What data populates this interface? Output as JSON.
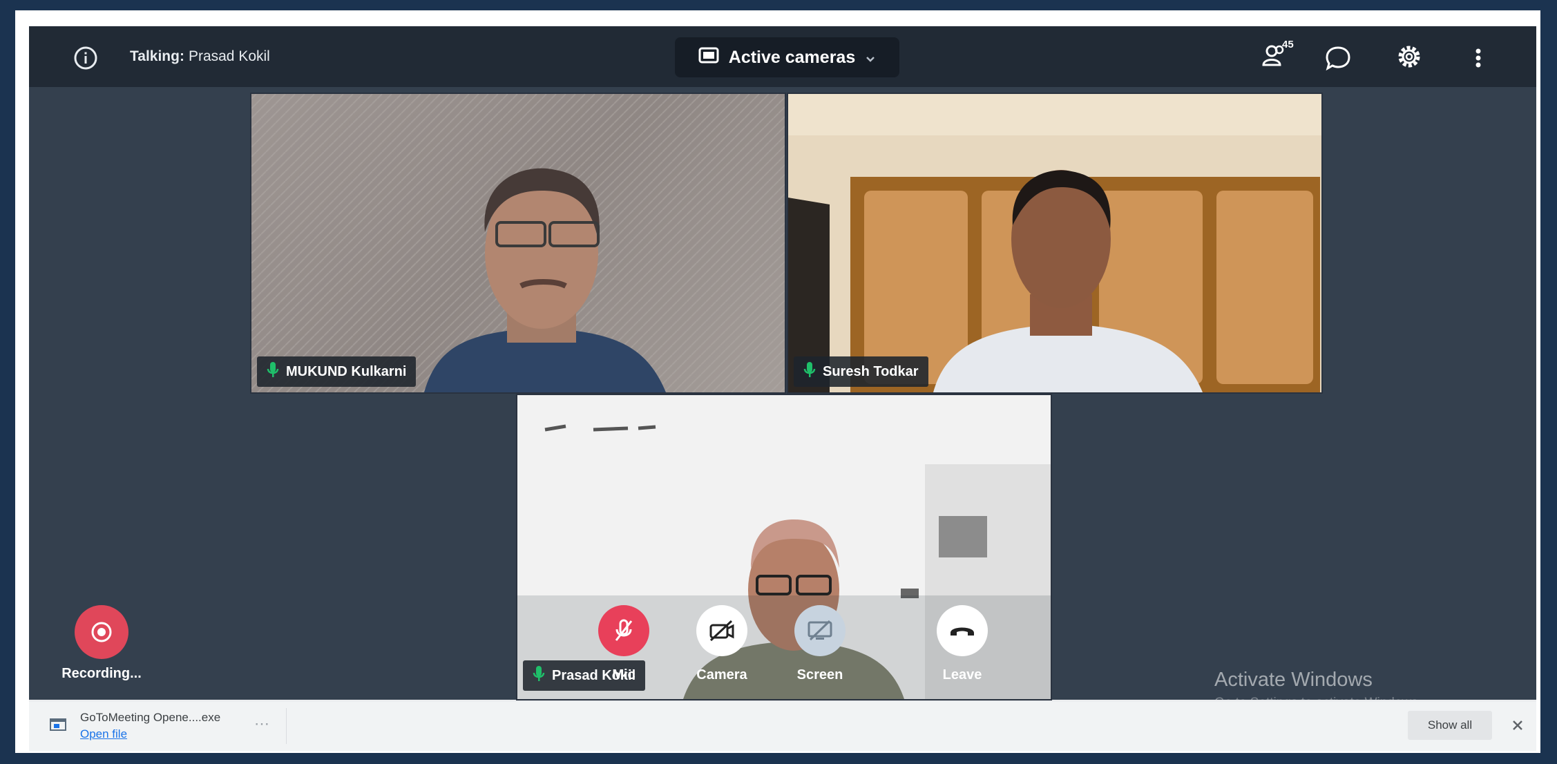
{
  "topbar": {
    "talking_label": "Talking:",
    "talking_name": "Prasad Kokil",
    "view_label": "Active cameras",
    "participants_count": "45",
    "icons": [
      "info-icon",
      "camera-view-icon",
      "participants-icon",
      "chat-icon",
      "settings-icon",
      "more-icon"
    ]
  },
  "participants": [
    {
      "name": "MUKUND Kulkarni"
    },
    {
      "name": "Suresh Todkar"
    },
    {
      "name": "Prasad Kokil"
    }
  ],
  "controls": {
    "recording": "Recording...",
    "mic": "Mic",
    "camera": "Camera",
    "screen": "Screen",
    "leave": "Leave"
  },
  "colors": {
    "recording_red": "#e0475a",
    "mic_red": "#e8405a",
    "app_bg": "#34404e",
    "topbar_bg": "#212a35",
    "talking_green": "#1fbf6a"
  },
  "watermark": {
    "title": "Activate Windows",
    "subtitle": "Go to Settings to activate Windows."
  },
  "downloads": {
    "file_name": "GoToMeeting Opene....exe",
    "open_link": "Open file",
    "show_all": "Show all"
  }
}
